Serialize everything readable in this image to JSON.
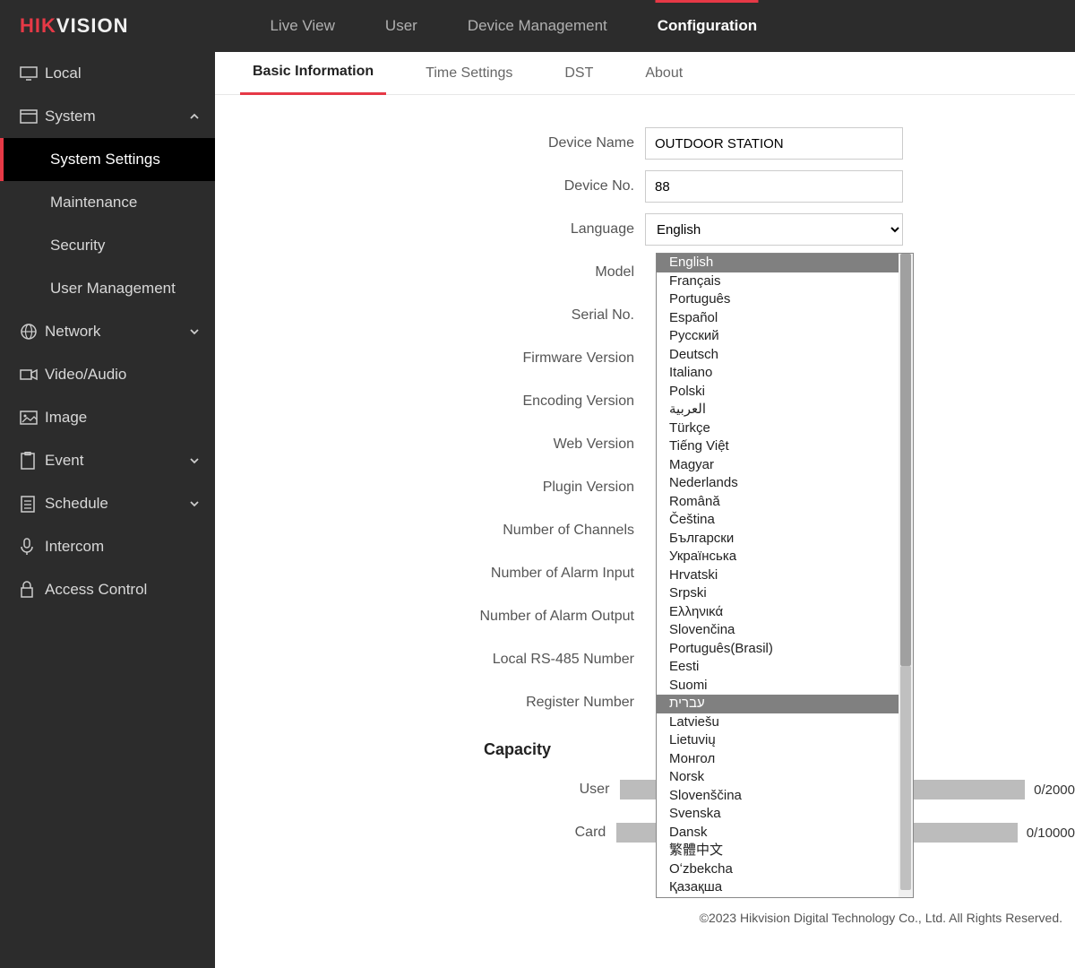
{
  "logo": {
    "part1": "HIK",
    "part2": "VISION"
  },
  "topnav": {
    "items": [
      {
        "label": "Live View"
      },
      {
        "label": "User"
      },
      {
        "label": "Device Management"
      },
      {
        "label": "Configuration",
        "active": true
      }
    ]
  },
  "sidebar": {
    "items": [
      {
        "label": "Local",
        "icon": "monitor"
      },
      {
        "label": "System",
        "icon": "window",
        "expanded": true,
        "children": [
          {
            "label": "System Settings",
            "active": true
          },
          {
            "label": "Maintenance"
          },
          {
            "label": "Security"
          },
          {
            "label": "User Management"
          }
        ]
      },
      {
        "label": "Network",
        "icon": "globe",
        "expand": true
      },
      {
        "label": "Video/Audio",
        "icon": "media"
      },
      {
        "label": "Image",
        "icon": "image"
      },
      {
        "label": "Event",
        "icon": "clipboard",
        "expand": true
      },
      {
        "label": "Schedule",
        "icon": "list",
        "expand": true
      },
      {
        "label": "Intercom",
        "icon": "mic"
      },
      {
        "label": "Access Control",
        "icon": "lock"
      }
    ]
  },
  "tabs": {
    "items": [
      {
        "label": "Basic Information",
        "active": true
      },
      {
        "label": "Time Settings"
      },
      {
        "label": "DST"
      },
      {
        "label": "About"
      }
    ]
  },
  "form": {
    "device_name_label": "Device Name",
    "device_name_value": "OUTDOOR STATION",
    "device_no_label": "Device No.",
    "device_no_value": "88",
    "language_label": "Language",
    "language_value": "English",
    "model_label": "Model",
    "serial_label": "Serial No.",
    "firmware_label": "Firmware Version",
    "encoding_label": "Encoding Version",
    "web_label": "Web Version",
    "plugin_label": "Plugin Version",
    "channels_label": "Number of Channels",
    "alarm_in_label": "Number of Alarm Input",
    "alarm_out_label": "Number of Alarm Output",
    "rs485_label": "Local RS-485 Number",
    "register_label": "Register Number"
  },
  "capacity": {
    "title": "Capacity",
    "user_label": "User",
    "user_text": "0/2000",
    "card_label": "Card",
    "card_text": "0/10000"
  },
  "languages": [
    "English",
    "Français",
    "Português",
    "Español",
    "Русский",
    "Deutsch",
    "Italiano",
    "Polski",
    "العربية",
    "Türkçe",
    "Tiếng Việt",
    "Magyar",
    "Nederlands",
    "Română",
    "Čeština",
    "Български",
    "Українська",
    "Hrvatski",
    "Srpski",
    "Ελληνικά",
    "Slovenčina",
    "Português(Brasil)",
    "Eesti",
    "Suomi",
    "עברית",
    "Latviešu",
    "Lietuvių",
    "Монгол",
    "Norsk",
    "Slovenščina",
    "Svenska",
    "Dansk",
    "繁體中文",
    "Oʻzbekcha",
    "Қазақша"
  ],
  "lang_selected_index": 0,
  "lang_hover_index": 24,
  "footer": "©2023 Hikvision Digital Technology Co., Ltd. All Rights Reserved."
}
